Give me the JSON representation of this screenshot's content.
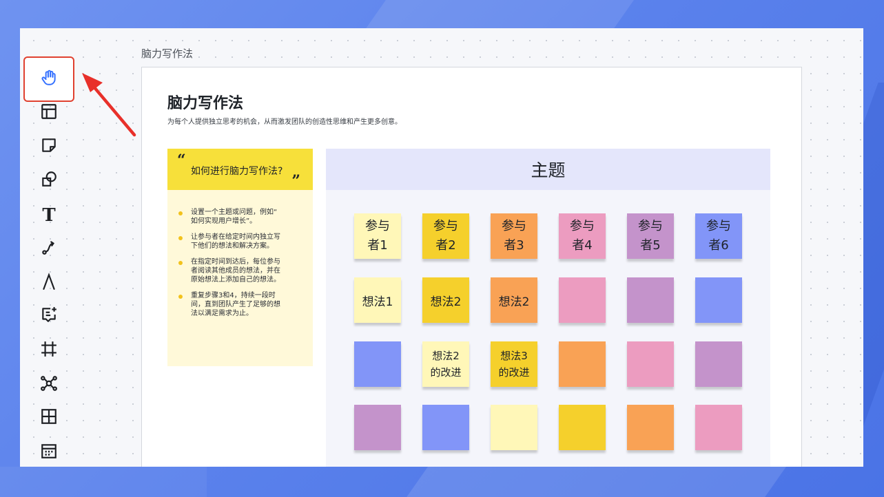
{
  "toolbar": {
    "tools": [
      {
        "name": "hand-tool",
        "icon": "hand-icon",
        "active": true
      },
      {
        "name": "template-tool",
        "icon": "layout-icon"
      },
      {
        "name": "sticky-note-tool",
        "icon": "sticky-note-icon"
      },
      {
        "name": "shape-tool",
        "icon": "shapes-icon"
      },
      {
        "name": "text-tool",
        "icon": "text-icon",
        "glyph": "T"
      },
      {
        "name": "connector-tool",
        "icon": "connector-icon"
      },
      {
        "name": "pen-tool",
        "icon": "pen-icon"
      },
      {
        "name": "comment-tool",
        "icon": "comment-add-icon"
      },
      {
        "name": "frame-tool",
        "icon": "frame-icon"
      },
      {
        "name": "mindmap-tool",
        "icon": "mindmap-icon"
      },
      {
        "name": "table-tool",
        "icon": "table-icon"
      },
      {
        "name": "calendar-tool",
        "icon": "calendar-icon"
      }
    ],
    "highlight_color": "#e0402f",
    "accent": "#3370ff"
  },
  "frame": {
    "label": "脑力写作法",
    "title": "脑力写作法",
    "subtitle": "为每个人提供独立思考的机会，从而激发团队的创造性思维和产生更多创意。"
  },
  "guide": {
    "quote_open": "“",
    "quote_close": "”",
    "heading": "如何进行脑力写作法?",
    "steps": [
      "设置一个主题或问题，例如“\n如何实现用户增长”。",
      "让参与者在给定时间内独立写\n下他们的想法和解决方案。",
      "在指定时间到达后，每位参与\n者阅读其他成员的想法，并在\n原始想法上添加自己的想法。",
      "重复步骤3和4，持续一段时\n间，直到团队产生了足够的想\n法以满足需求为止。"
    ]
  },
  "board": {
    "title": "主题",
    "rows": [
      [
        {
          "text": "参与\n者1",
          "color": "#fff7b8"
        },
        {
          "text": "参与\n者2",
          "color": "#f5d02c"
        },
        {
          "text": "参与\n者3",
          "color": "#f9a255"
        },
        {
          "text": "参与\n者4",
          "color": "#ec9cc0"
        },
        {
          "text": "参与\n者5",
          "color": "#c493cb"
        },
        {
          "text": "参与\n者6",
          "color": "#8295f8"
        }
      ],
      [
        {
          "text": "想法1",
          "color": "#fff7b8"
        },
        {
          "text": "想法2",
          "color": "#f5d02c"
        },
        {
          "text": "想法2",
          "color": "#f9a255"
        },
        {
          "text": "",
          "color": "#ec9cc0"
        },
        {
          "text": "",
          "color": "#c493cb"
        },
        {
          "text": "",
          "color": "#8295f8"
        }
      ],
      [
        {
          "text": "",
          "color": "#8295f8"
        },
        {
          "text": "想法2\n的改进",
          "color": "#fff7b8"
        },
        {
          "text": "想法3\n的改进",
          "color": "#f5d02c"
        },
        {
          "text": "",
          "color": "#f9a255"
        },
        {
          "text": "",
          "color": "#ec9cc0"
        },
        {
          "text": "",
          "color": "#c493cb"
        }
      ],
      [
        {
          "text": "",
          "color": "#c493cb"
        },
        {
          "text": "",
          "color": "#8295f8"
        },
        {
          "text": "",
          "color": "#fff7b8"
        },
        {
          "text": "",
          "color": "#f5d02c"
        },
        {
          "text": "",
          "color": "#f9a255"
        },
        {
          "text": "",
          "color": "#ec9cc0"
        }
      ]
    ]
  }
}
